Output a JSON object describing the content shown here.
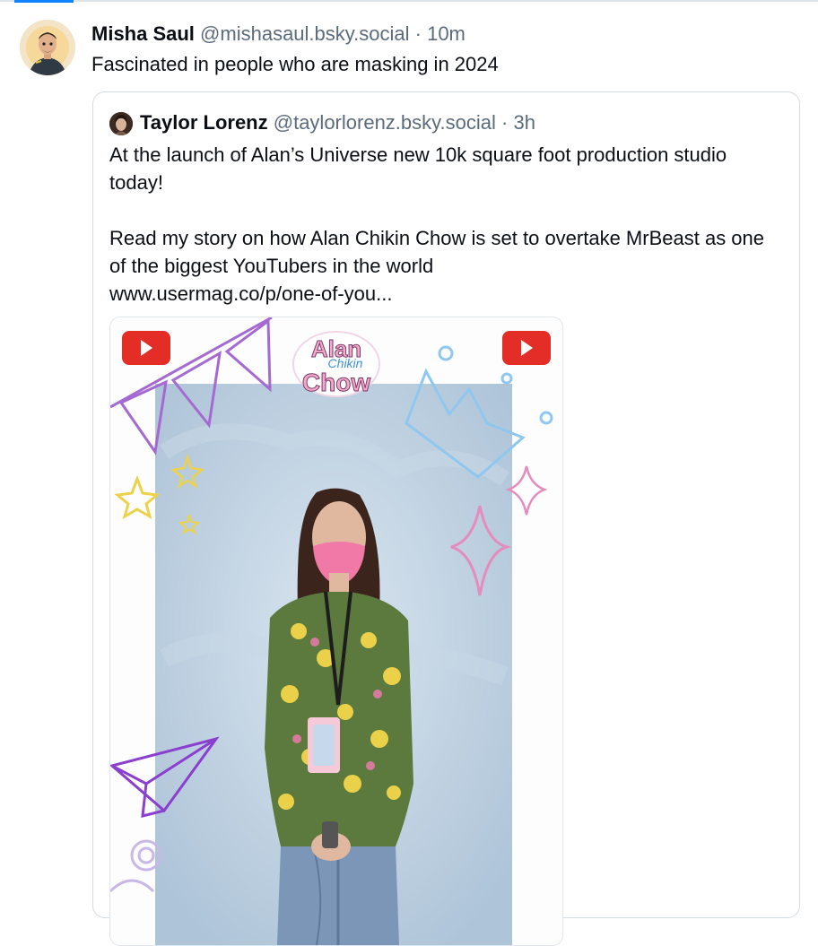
{
  "post": {
    "author": {
      "display_name": "Misha Saul",
      "handle": "@mishasaul.bsky.social",
      "separator": "·",
      "time": "10m"
    },
    "text": "Fascinated in people who are masking in 2024"
  },
  "quote": {
    "author": {
      "display_name": "Taylor Lorenz",
      "handle": "@taylorlorenz.bsky.social",
      "separator": "·",
      "time": "3h"
    },
    "text_line1": "At the launch of Alan’s Universe new 10k square foot production studio today!",
    "text_line2": "Read my story on how Alan Chikin Chow is set to overtake MrBeast as one of the biggest YouTubers in the world",
    "link_text": "www.usermag.co/p/one-of-you...",
    "image": {
      "logo_line1": "Alan",
      "logo_line2": "Chikin",
      "logo_line3": "Chow"
    }
  },
  "icons": [
    "youtube-icon",
    "paper-plane-icon",
    "star-icon",
    "crown-icon",
    "sparkle-icon"
  ],
  "colors": {
    "accent": "#1083fe",
    "muted_text": "#5b6b7c",
    "border": "#d4dbe3"
  }
}
